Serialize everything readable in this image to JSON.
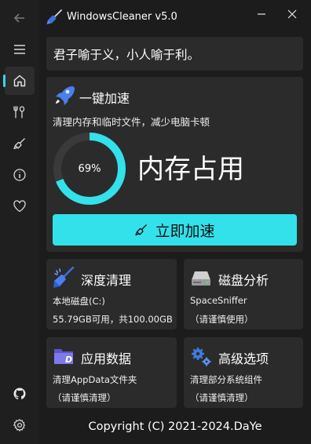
{
  "app": {
    "title": "WindowsCleaner v5.0"
  },
  "quote": "君子喻于义，小人喻于利。",
  "accelerate": {
    "title": "一键加速",
    "description": "清理内存和临时文件，减少电脑卡顿",
    "memory_percent_text": "69%",
    "memory_fraction": 0.69,
    "memory_label": "内存占用",
    "button_label": "立即加速"
  },
  "tiles": [
    {
      "title": "深度清理",
      "line1": "本地磁盘(C:)",
      "line2": "55.79GB可用，共100.00GB"
    },
    {
      "title": "磁盘分析",
      "line1": "SpaceSniffer",
      "line2": "（请谨慎使用）"
    },
    {
      "title": "应用数据",
      "line1": "清理AppData文件夹",
      "line2": "（请谨慎清理）"
    },
    {
      "title": "高级选项",
      "line1": "清理部分系统组件",
      "line2": "（请谨慎清理）"
    }
  ],
  "copyright": "Copyright (C) 2021-2024.DaYe",
  "colors": {
    "accent": "#33e1ea",
    "ring_track": "#3a3a3a",
    "background": "#1c1c1c",
    "card": "#2b2b2b"
  }
}
